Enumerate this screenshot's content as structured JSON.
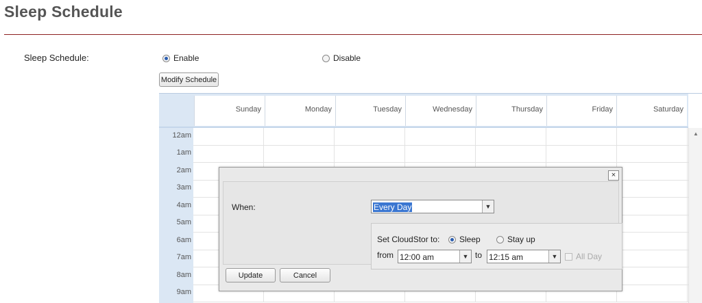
{
  "page": {
    "title": "Sleep Schedule"
  },
  "schedule": {
    "label": "Sleep Schedule:",
    "enable_label": "Enable",
    "disable_label": "Disable",
    "selected": "Enable",
    "modify_button": "Modify Schedule"
  },
  "calendar": {
    "days": [
      "Sunday",
      "Monday",
      "Tuesday",
      "Wednesday",
      "Thursday",
      "Friday",
      "Saturday"
    ],
    "hours": [
      "12am",
      "1am",
      "2am",
      "3am",
      "4am",
      "5am",
      "6am",
      "7am",
      "8am",
      "9am"
    ]
  },
  "dialog": {
    "close": "×",
    "when_label": "When:",
    "when_value": "Every Day",
    "set_label": "Set CloudStor to:",
    "sleep_label": "Sleep",
    "stay_up_label": "Stay up",
    "mode_selected": "Sleep",
    "from_label": "from",
    "from_value": "12:00 am",
    "to_label": "to",
    "to_value": "12:15 am",
    "all_day_label": "All Day",
    "update_button": "Update",
    "cancel_button": "Cancel"
  },
  "icons": {
    "select_arrow": "chevron-down-icon",
    "scroll_up": "triangle-up-icon"
  },
  "colors": {
    "rule": "#8b1e1e",
    "calendar_header": "#dbe7f4",
    "selection": "#3a76d1",
    "radio_on": "#2a5db0"
  }
}
